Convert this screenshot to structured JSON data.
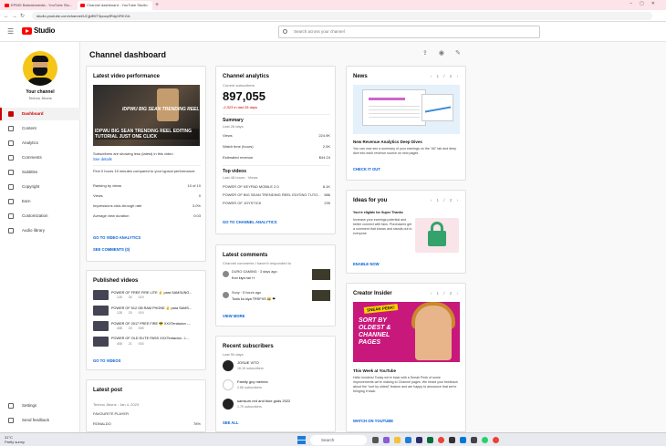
{
  "browser": {
    "tabs": [
      "EPMG Bahrainmedia - YouTube Stu...",
      "Channel dashboard - YouTube Studio"
    ],
    "url": "studio.youtube.com/channel/UCjjdEtlT3ycoqrfRdyGRKGA"
  },
  "header": {
    "app_name": "Studio",
    "search_placeholder": "Search across your channel"
  },
  "sidebar": {
    "channel_title": "Your channel",
    "channel_name": "Techno Jibons",
    "items": [
      {
        "label": "Dashboard",
        "icon": "dashboard-icon",
        "active": true
      },
      {
        "label": "Content",
        "icon": "content-icon"
      },
      {
        "label": "Analytics",
        "icon": "analytics-icon"
      },
      {
        "label": "Comments",
        "icon": "comments-icon"
      },
      {
        "label": "Subtitles",
        "icon": "subtitles-icon"
      },
      {
        "label": "Copyright",
        "icon": "copyright-icon"
      },
      {
        "label": "Earn",
        "icon": "earn-icon"
      },
      {
        "label": "Customization",
        "icon": "customization-icon"
      },
      {
        "label": "Audio library",
        "icon": "audio-library-icon"
      }
    ],
    "bottom": [
      {
        "label": "Settings",
        "icon": "settings-icon"
      },
      {
        "label": "Send feedback",
        "icon": "feedback-icon"
      }
    ]
  },
  "page_title": "Channel dashboard",
  "latest_video": {
    "title": "Latest video performance",
    "thumb_text_1": "IDPWU BIG SEAN TRENDING REEL",
    "thumb_text_2": "IDPWU BIG SEAN TRENDING REEL EDITING TUTORIAL JUST ONE CLICK",
    "note": "Subscribers are showing less (latest) in this video",
    "note_link": "See details",
    "first_hours": "First 0 hours 15 minutes compared to your typical performance:",
    "rows": [
      {
        "label": "Ranking by views",
        "value": "10 of 10"
      },
      {
        "label": "Views",
        "value": "0"
      },
      {
        "label": "Impressions click-through rate",
        "value": "3.0%"
      },
      {
        "label": "Average view duration",
        "value": "0:03"
      }
    ],
    "link_analytics": "GO TO VIDEO ANALYTICS",
    "link_comments": "SEE COMMENTS (0)"
  },
  "published": {
    "title": "Published videos",
    "videos": [
      {
        "title": "POWER OF FREE FIRE LITE ✌ para SAMSUNG...",
        "stats": "126 30 019"
      },
      {
        "title": "POWER OF 512 GB RAM PHONE ✌ para SAMS...",
        "stats": "128 20 019"
      },
      {
        "title": "POWER OF 2017 FREE FIRE 😎 XXXTentacion -...",
        "stats": "408 20 005"
      },
      {
        "title": "POWER OF OLD ELITE PASS XXXTentacion - L...",
        "stats": "408 21 003"
      }
    ],
    "link": "GO TO VIDEOS"
  },
  "latest_post": {
    "title": "Latest post",
    "author": "Techno Jibons",
    "date": "Jan 4, 2023",
    "body": "FAVOURITE PLAYER",
    "row_label": "RONALDO",
    "row_value": "78%"
  },
  "analytics": {
    "title": "Channel analytics",
    "subs_label": "Current subscribers",
    "subs_value": "897,055",
    "subs_change": "-2,323 in last 28 days",
    "summary_title": "Summary",
    "summary_sub": "Last 28 days",
    "metrics": [
      {
        "label": "Views",
        "value": "224.9K"
      },
      {
        "label": "Watch time (hours)",
        "value": "2.0K"
      },
      {
        "label": "Estimated revenue",
        "value": "$44.24"
      }
    ],
    "top_title": "Top videos",
    "top_sub": "Last 48 hours · Views",
    "top_videos": [
      {
        "label": "POWER OF KEYPAD MOBILE 2.0",
        "value": "8.1K"
      },
      {
        "label": "POWER OF BIG SEAN TRENDING REEL EDITING TUTO...",
        "value": "586"
      },
      {
        "label": "POWER OF JOYSTICK",
        "value": "239"
      }
    ],
    "link": "GO TO CHANNEL ANALYTICS"
  },
  "comments": {
    "title": "Latest comments",
    "sub": "Channel comments I haven't responded to",
    "items": [
      {
        "name": "DURO GAMING · 3 days ago",
        "body": "Kon kiya hai 👀"
      },
      {
        "name": "Sony · 5 hours ago",
        "body": "Tools ko kiya TRSFXS 😂 ❤"
      }
    ],
    "link": "VIEW MORE"
  },
  "recent_subs": {
    "title": "Recent subscribers",
    "sub": "Last 90 days",
    "items": [
      {
        "name": "JOSUE VITO",
        "count": "16.1K subscribers"
      },
      {
        "name": "Family guy memes",
        "count": "2.6K subscribers"
      },
      {
        "name": "samsum red and blue gods 2022",
        "count": "1.7K subscribers"
      }
    ],
    "link": "SEE ALL"
  },
  "news": {
    "title": "News",
    "pager": "1 / 2",
    "headline": "New Revenue Analytics Deep Dives",
    "body": "You can now see a summary of your earnings on the \"All\" tab and deep dive into each revenue source on new pages",
    "link": "CHECK IT OUT"
  },
  "ideas": {
    "title": "Ideas for you",
    "pager": "1 / 2",
    "heading": "You're eligible for Super Thanks",
    "body": "Increase your earnings potential and better connect with fans. Purchasers get a comment that shows and stands out to everyone",
    "link": "ENABLE NOW"
  },
  "insider": {
    "title": "Creator Insider",
    "pager": "1 / 2",
    "img_badge": "SNEAK PEEK!",
    "img_text": "SORT BY OLDEST & CHANNEL PAGES",
    "headline": "This Week at YouTube",
    "body": "Hello Insiders! Today we're back with a Sneak Peek of some improvements we're making to Channel pages. We heard your feedback about the \"sort by oldest\" feature and are happy to announce that we're bringing it back.",
    "link": "WATCH ON YOUTUBE"
  },
  "taskbar": {
    "weather_temp": "31°C",
    "weather_desc": "Partly sunny",
    "search": "Search"
  }
}
